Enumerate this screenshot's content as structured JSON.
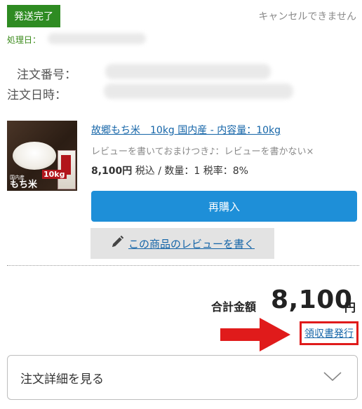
{
  "status": {
    "badge": "発送完了",
    "cancel_note": "キャンセルできません",
    "processed_label": "処理日：",
    "badge_color": "#2e8b22"
  },
  "order": {
    "number_label": "注文番号：",
    "date_label": "注文日時："
  },
  "product": {
    "image_text": "もち米",
    "image_badge": "10kg",
    "image_tag": "国内産",
    "title": "故郷もち米　10kg 国内産 - 内容量：10kg",
    "review_note": "レビューを書いておまけつき♪：レビューを書かない×",
    "price": "8,100円",
    "price_detail": " 税込 / 数量：1 税率：8%"
  },
  "buttons": {
    "rebuy": "再購入",
    "write_review": "この商品のレビューを書く",
    "rebuy_color": "#1e8fd8"
  },
  "total": {
    "label": "合計金額",
    "value": "8,100",
    "unit": "円"
  },
  "receipt": {
    "label": "領収書発行",
    "highlight_color": "#e01b1b"
  },
  "details": {
    "label": "注文詳細を見る"
  },
  "icons": {
    "pencil": "pencil-icon",
    "chevron": "chevron-down-icon",
    "arrow": "arrow-right-icon"
  }
}
